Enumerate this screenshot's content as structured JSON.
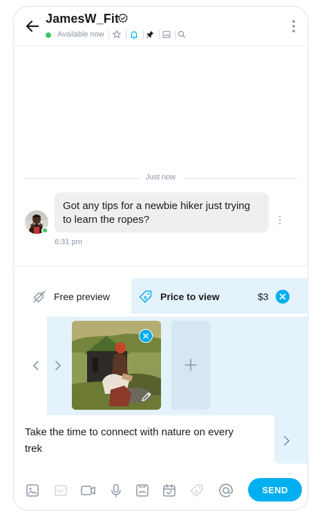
{
  "header": {
    "name": "JamesW_Fit",
    "status": "Available now",
    "icons": [
      "back-arrow-icon",
      "verified-icon",
      "star-icon",
      "bell-icon",
      "pin-icon",
      "image-icon",
      "search-icon",
      "more-vertical-icon"
    ]
  },
  "chat": {
    "divider_label": "Just now",
    "messages": [
      {
        "text": "Got any tips for a newbie hiker just trying to learn the ropes?",
        "time": "6:31 pm"
      }
    ]
  },
  "composer": {
    "tabs": {
      "free_preview": "Free preview",
      "price_to_view": "Price to view"
    },
    "price": "$3",
    "message_text": "Take the time to connect with nature on every trek",
    "send_label": "SEND",
    "toolbar_icons": [
      "image-icon",
      "gif-icon",
      "video-icon",
      "microphone-icon",
      "vault-icon",
      "calendar-icon",
      "tag-icon",
      "at-icon"
    ]
  },
  "colors": {
    "accent": "#00aff0",
    "online": "#3cc85f",
    "composer_bg": "#e4f2fc",
    "bubble_bg": "#eeeff1",
    "muted_text": "#8a96a3"
  }
}
